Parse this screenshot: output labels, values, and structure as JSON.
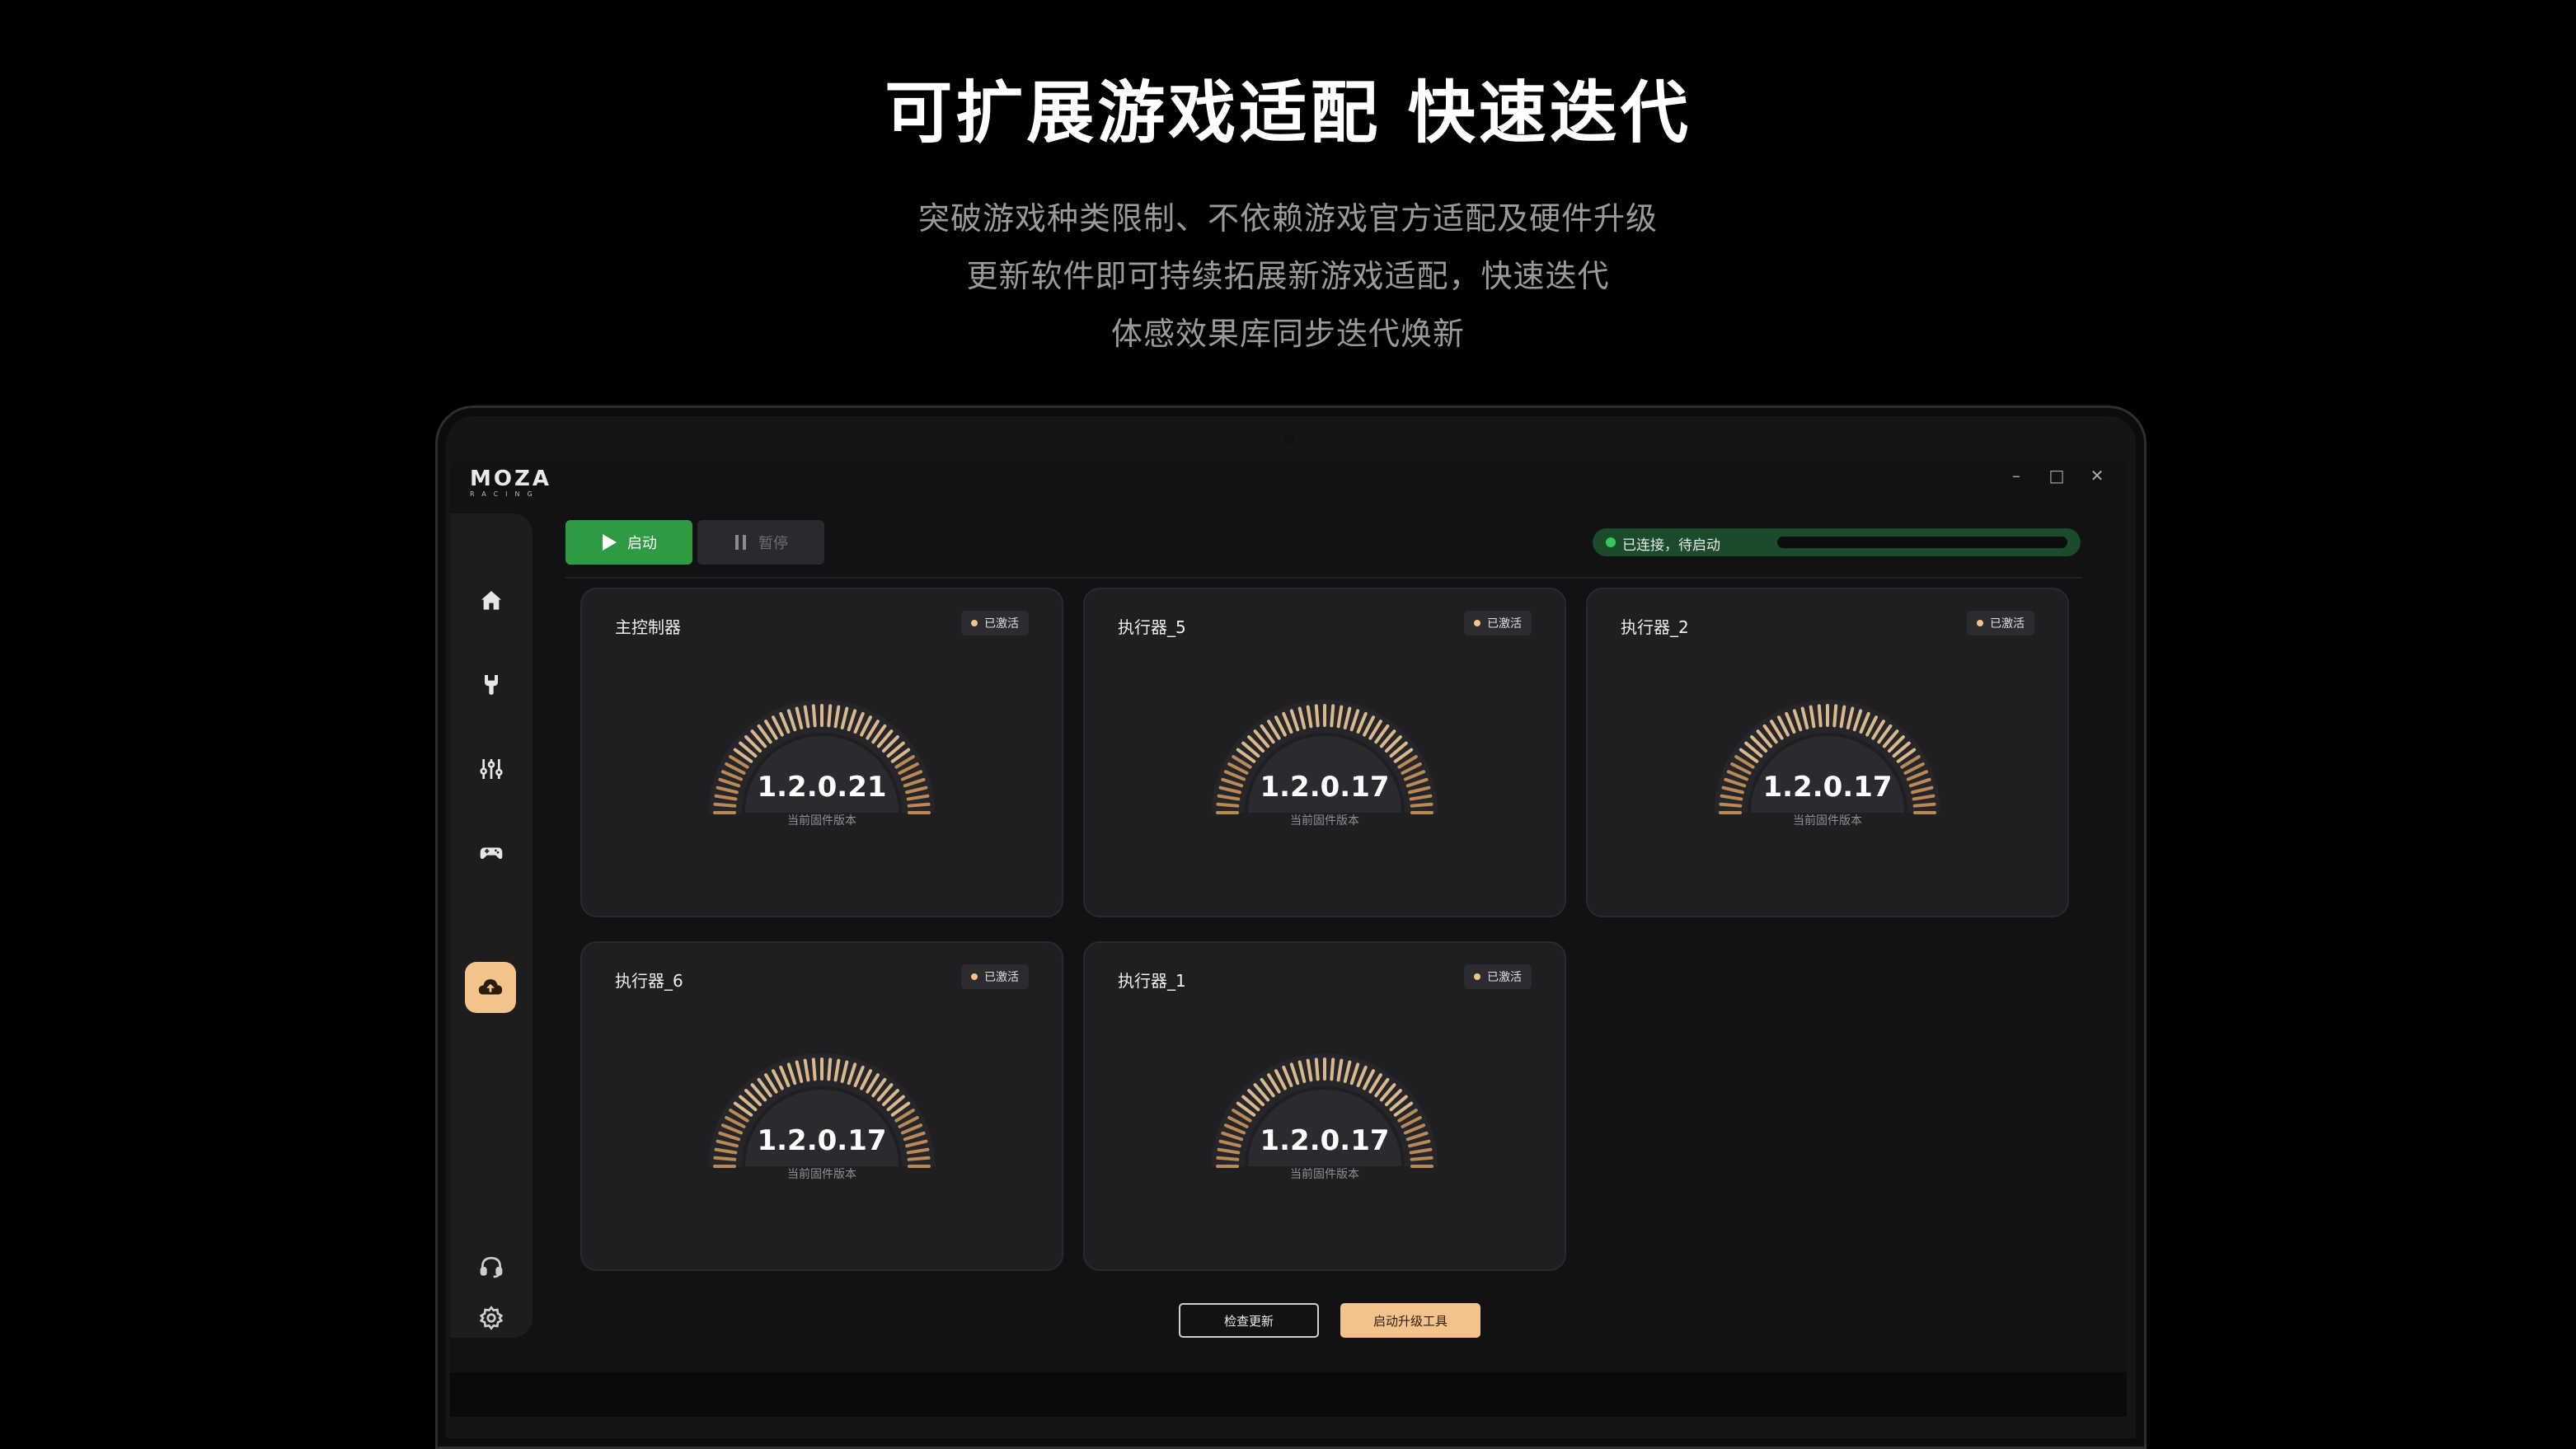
{
  "promo": {
    "headline": "可扩展游戏适配 快速迭代",
    "lines": [
      "突破游戏种类限制、不依赖游戏官方适配及硬件升级",
      "更新软件即可持续拓展新游戏适配，快速迭代",
      "体感效果库同步迭代焕新"
    ]
  },
  "app": {
    "logo_main": "MOZA",
    "logo_sub": "RACING",
    "window_controls": {
      "minimize": "–",
      "maximize": "□",
      "close": "✕"
    },
    "sidebar": {
      "items": [
        {
          "icon": "home-icon"
        },
        {
          "icon": "wrench-icon"
        },
        {
          "icon": "sliders-icon"
        },
        {
          "icon": "gamepad-icon"
        },
        {
          "icon": "cloud-upload-icon",
          "active": true
        }
      ],
      "bottom": [
        {
          "icon": "headset-icon"
        },
        {
          "icon": "gear-icon"
        }
      ],
      "accent": "#f2c38a"
    },
    "toolbar": {
      "start_label": "启动",
      "pause_label": "暂停",
      "status_text": "已连接，待启动",
      "status_color": "#35c759",
      "start_color": "#2e9b43"
    },
    "devices": [
      {
        "name": "主控制器",
        "badge": "已激活",
        "version": "1.2.0.21",
        "version_label": "当前固件版本"
      },
      {
        "name": "执行器_5",
        "badge": "已激活",
        "version": "1.2.0.17",
        "version_label": "当前固件版本"
      },
      {
        "name": "执行器_2",
        "badge": "已激活",
        "version": "1.2.0.17",
        "version_label": "当前固件版本"
      },
      {
        "name": "执行器_6",
        "badge": "已激活",
        "version": "1.2.0.17",
        "version_label": "当前固件版本"
      },
      {
        "name": "执行器_1",
        "badge": "已激活",
        "version": "1.2.0.17",
        "version_label": "当前固件版本"
      }
    ],
    "footer": {
      "check_update_label": "检查更新",
      "launch_tool_label": "启动升级工具"
    }
  }
}
